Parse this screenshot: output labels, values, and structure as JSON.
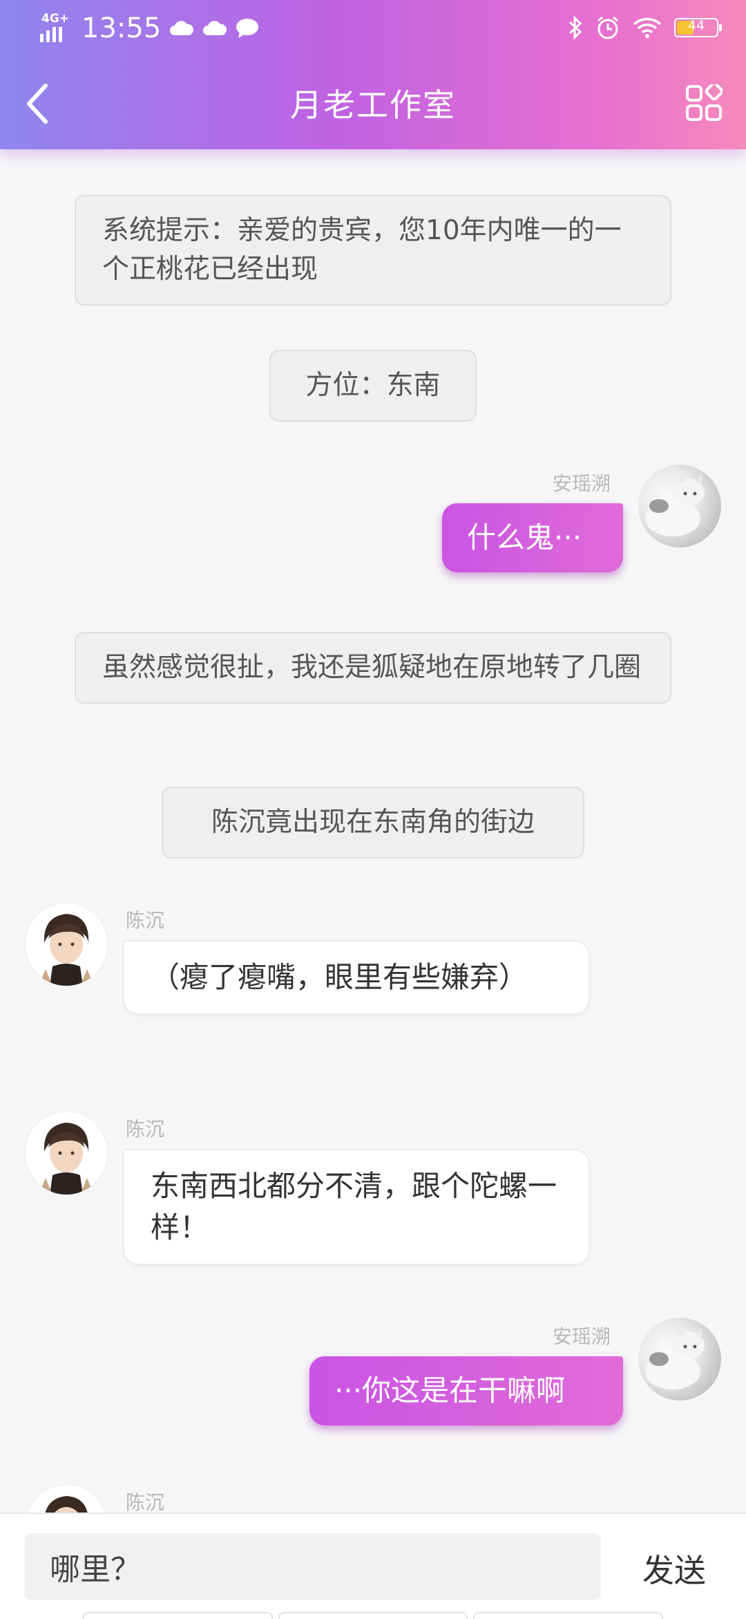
{
  "status_bar": {
    "network": "4G+",
    "time": "13:55",
    "battery": "44",
    "battery_level": 0.44,
    "left_icons": [
      "cloud-icon",
      "cloud-icon",
      "message-bubble-icon"
    ],
    "right_icons": [
      "bluetooth-icon",
      "alarm-icon",
      "wifi-icon",
      "battery-icon"
    ]
  },
  "header": {
    "title": "月老工作室",
    "back_icon": "chevron-left-icon",
    "menu_icon": "grid-menu-icon"
  },
  "messages": [
    {
      "type": "system",
      "text": "系统提示：亲爱的贵宾，您10年内唯一的一个正桃花已经出现"
    },
    {
      "type": "system",
      "text": "方位：东南"
    },
    {
      "type": "me",
      "name": "安瑶溯",
      "text": "什么鬼···"
    },
    {
      "type": "system",
      "text": "虽然感觉很扯，我还是狐疑地在原地转了几圈"
    },
    {
      "type": "system",
      "text": "陈沉竟出现在东南角的街边"
    },
    {
      "type": "other",
      "name": "陈沉",
      "text": "（瘪了瘪嘴，眼里有些嫌弃）"
    },
    {
      "type": "other",
      "name": "陈沉",
      "text": "东南西北都分不清，跟个陀螺一样！"
    },
    {
      "type": "me",
      "name": "安瑶溯",
      "text": "···你这是在干嘛啊"
    },
    {
      "type": "other",
      "name": "陈沉",
      "text": ""
    }
  ],
  "composer": {
    "input_value": "哪里？",
    "send_label": "发送"
  },
  "colors": {
    "header_gradient": [
      "#8f86ee",
      "#c062e2",
      "#f58bbb"
    ],
    "my_bubble": "#d25fe0",
    "other_bubble": "#ffffff",
    "system_bubble": "#efefef"
  }
}
